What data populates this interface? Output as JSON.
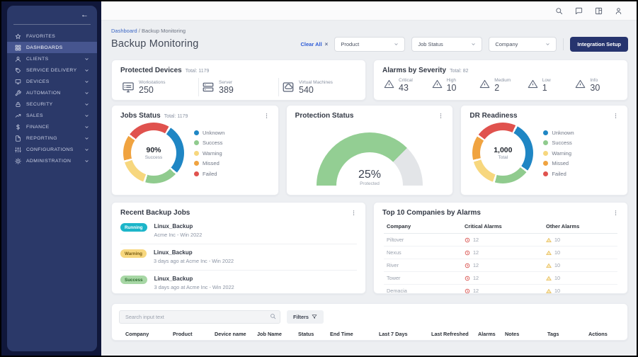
{
  "topbar": {
    "icons": [
      "search",
      "chat",
      "panels",
      "user"
    ]
  },
  "sidebar": {
    "back_icon": "←",
    "items": [
      {
        "label": "FAVORITES",
        "icon": "star",
        "chevron": false,
        "active": false
      },
      {
        "label": "DASHBOARDS",
        "icon": "dashboard",
        "chevron": false,
        "active": true
      },
      {
        "label": "CLIENTS",
        "icon": "user",
        "chevron": true,
        "active": false
      },
      {
        "label": "SERVICE DELIVERY",
        "icon": "tag",
        "chevron": true,
        "active": false
      },
      {
        "label": "DEVICES",
        "icon": "monitor",
        "chevron": true,
        "active": false
      },
      {
        "label": "AUTOMATION",
        "icon": "wrench",
        "chevron": true,
        "active": false
      },
      {
        "label": "SECURITY",
        "icon": "lock",
        "chevron": true,
        "active": false
      },
      {
        "label": "SALES",
        "icon": "trend",
        "chevron": true,
        "active": false
      },
      {
        "label": "FINANCE",
        "icon": "dollar",
        "chevron": true,
        "active": false
      },
      {
        "label": "REPORTING",
        "icon": "file",
        "chevron": true,
        "active": false
      },
      {
        "label": "CONFIGURATIONS",
        "icon": "sliders",
        "chevron": true,
        "active": false
      },
      {
        "label": "ADMINISTRATION",
        "icon": "gear",
        "chevron": true,
        "active": false
      }
    ]
  },
  "header": {
    "breadcrumb": {
      "link": "Dashboard",
      "sep": "/",
      "current": "Backup Monitoring"
    },
    "title": "Backup Monitoring",
    "clear_all": "Clear All",
    "clear_all_x": "×",
    "filters": [
      {
        "label": "Product"
      },
      {
        "label": "Job Status"
      },
      {
        "label": "Company"
      }
    ],
    "integration_button": "Integration Setup"
  },
  "protected_devices": {
    "title": "Protected Devices",
    "total_label": "Total: 1179",
    "stats": [
      {
        "label": "Workstations",
        "value": "250"
      },
      {
        "label": "Server",
        "value": "389"
      },
      {
        "label": "Virtual Machines",
        "value": "540"
      }
    ]
  },
  "alarms_by_severity": {
    "title": "Alarms by Severity",
    "total_label": "Total: 82",
    "stats": [
      {
        "label": "Critical",
        "value": "43",
        "color": "#d64541"
      },
      {
        "label": "High",
        "value": "10",
        "color": "#f0a23c"
      },
      {
        "label": "Medium",
        "value": "2",
        "color": "#f0cf6f"
      },
      {
        "label": "Low",
        "value": "1",
        "color": "#56c0d8"
      },
      {
        "label": "Info",
        "value": "30",
        "color": "#2289c9"
      }
    ]
  },
  "legend": {
    "items": [
      {
        "label": "Unknown",
        "color": "#1f86c4"
      },
      {
        "label": "Success",
        "color": "#90cb8e"
      },
      {
        "label": "Warning",
        "color": "#f7d77e"
      },
      {
        "label": "Missed",
        "color": "#f0a340"
      },
      {
        "label": "Failed",
        "color": "#e0524e"
      }
    ]
  },
  "jobs_status": {
    "title": "Jobs Status",
    "total_label": "Total: 1179",
    "center_value": "90%",
    "center_label": "Success"
  },
  "protection_status": {
    "title": "Protection Status",
    "center_value": "25%",
    "center_label": "Protected"
  },
  "dr_readiness": {
    "title": "DR Readiness",
    "center_value": "1,000",
    "center_label": "Total"
  },
  "recent_jobs": {
    "title": "Recent Backup Jobs",
    "items": [
      {
        "badge": "Running",
        "name": "Linux_Backup",
        "detail": "Acme Inc - Win 2022"
      },
      {
        "badge": "Warning",
        "name": "Linux_Backup",
        "detail": "3 days ago at Acme Inc - Win 2022"
      },
      {
        "badge": "Success",
        "name": "Linux_Backup",
        "detail": "3 days ago at Acme Inc - Win 2022"
      }
    ]
  },
  "top_companies": {
    "title": "Top 10 Companies by Alarms",
    "columns": [
      "Company",
      "Critical Alarms",
      "Other Alarms"
    ],
    "critical_color": "#d64541",
    "other_color": "#e6b84c",
    "rows": [
      {
        "company": "Piltover",
        "critical": "12",
        "other": "10"
      },
      {
        "company": "Nexus",
        "critical": "12",
        "other": "10"
      },
      {
        "company": "River",
        "critical": "12",
        "other": "10"
      },
      {
        "company": "Tower",
        "critical": "12",
        "other": "10"
      },
      {
        "company": "Demacia",
        "critical": "12",
        "other": "10"
      }
    ]
  },
  "jobs_table": {
    "search_placeholder": "Search input text",
    "filters_label": "Filters",
    "columns": [
      "Company",
      "Product",
      "Device name",
      "Job Name",
      "Status",
      "End Time",
      "Last 7 Days",
      "Last Refreshed",
      "Alarms",
      "Notes",
      "Tags",
      "Actions"
    ]
  },
  "chart_data": [
    {
      "type": "pie",
      "title": "Jobs Status",
      "total": 1179,
      "center_value": "90%",
      "center_label": "Success",
      "legend_position": "right",
      "labels": [
        "Unknown",
        "Success",
        "Warning",
        "Missed",
        "Failed"
      ],
      "approx_percents": [
        27,
        17,
        15,
        13,
        28
      ],
      "colors": [
        "#1f86c4",
        "#90cb8e",
        "#f7d77e",
        "#f0a340",
        "#e0524e"
      ]
    },
    {
      "type": "gauge",
      "title": "Protection Status",
      "value_label": "25%",
      "sub_label": "Protected",
      "arc_filled_fraction": 0.75,
      "fill_color": "#93ce93",
      "track_color": "#e3e5e8"
    },
    {
      "type": "pie",
      "title": "DR Readiness",
      "total": "1,000",
      "center_value": "1,000",
      "center_label": "Total",
      "legend_position": "right",
      "labels": [
        "Unknown",
        "Success",
        "Warning",
        "Missed",
        "Failed"
      ],
      "approx_percents": [
        27,
        18,
        15,
        13,
        27
      ],
      "colors": [
        "#1f86c4",
        "#90cb8e",
        "#f7d77e",
        "#f0a340",
        "#e0524e"
      ]
    }
  ]
}
